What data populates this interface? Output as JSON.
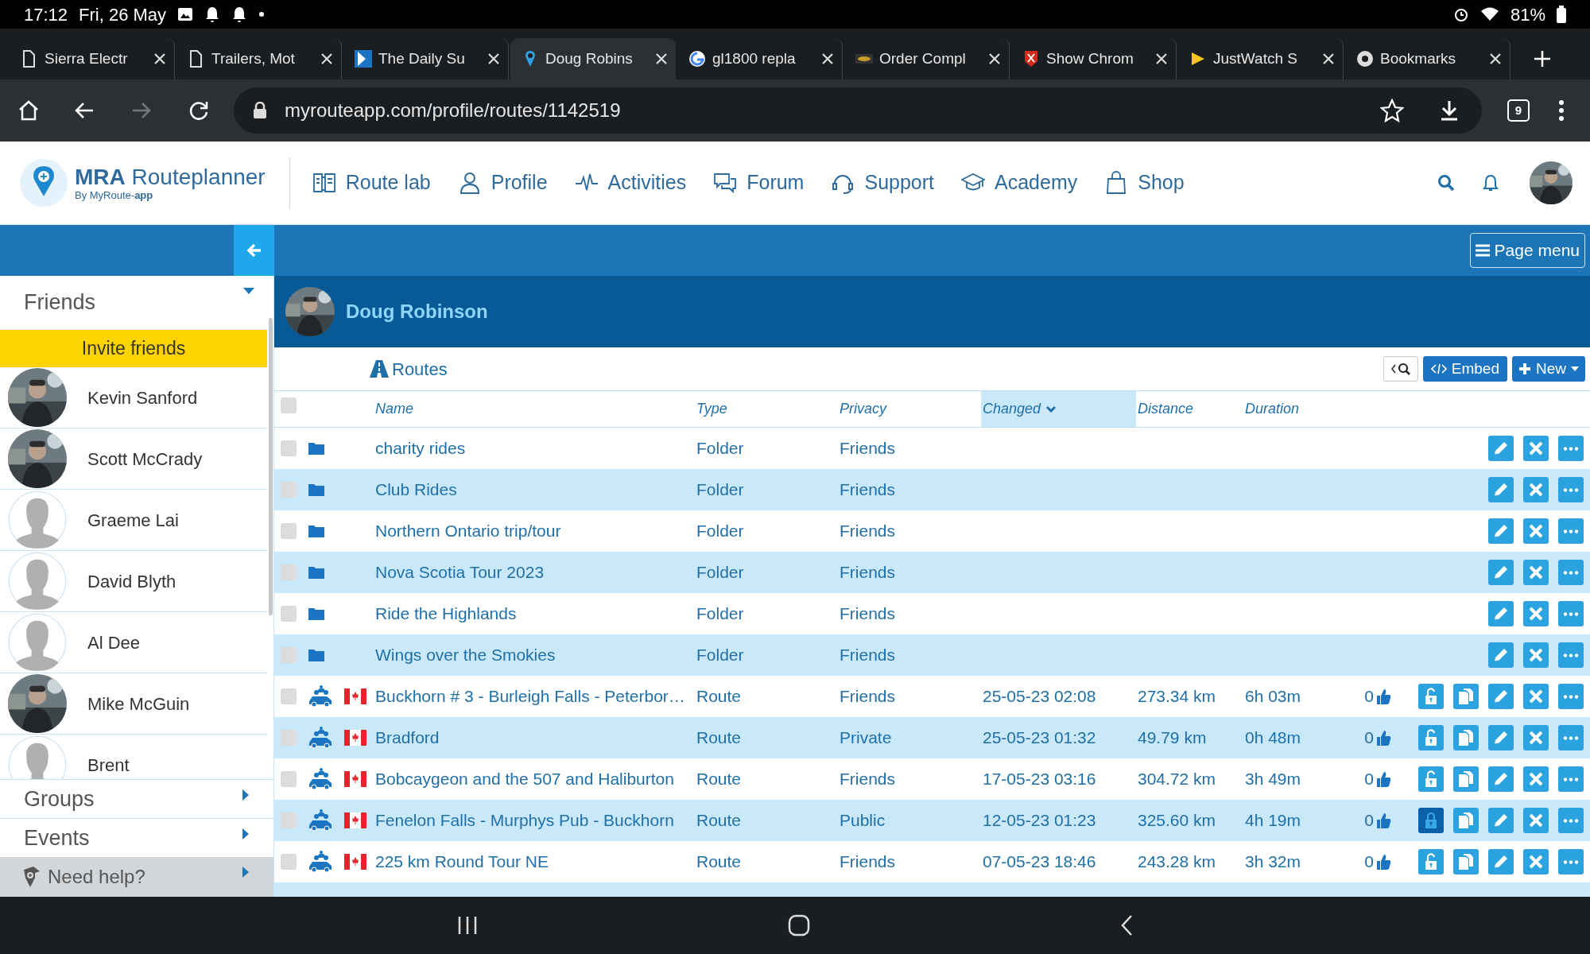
{
  "status_bar": {
    "time": "17:12",
    "date": "Fri, 26 May",
    "battery": "81%"
  },
  "browser": {
    "tabs": [
      {
        "title": "Sierra Electr",
        "selected": false
      },
      {
        "title": "Trailers, Mot",
        "selected": false
      },
      {
        "title": "The Daily Su",
        "selected": false
      },
      {
        "title": "Doug Robins",
        "selected": true
      },
      {
        "title": "gl1800 repla",
        "selected": false
      },
      {
        "title": "Order Compl",
        "selected": false
      },
      {
        "title": "Show Chrom",
        "selected": false
      },
      {
        "title": "JustWatch S",
        "selected": false
      },
      {
        "title": "Bookmarks",
        "selected": false
      }
    ],
    "url": "myrouteapp.com/profile/routes/1142519",
    "tab_count": "9"
  },
  "site_nav": {
    "logo_title": "**MRA** Routeplanner",
    "logo_subtitle": "By MyRoute-**app**",
    "items": [
      "Route lab",
      "Profile",
      "Activities",
      "Forum",
      "Support",
      "Academy",
      "Shop"
    ]
  },
  "page_menu": "Page menu",
  "sidebar": {
    "friends_header": "Friends",
    "expanded": true,
    "invite": "Invite friends",
    "friends": [
      {
        "name": "Kevin Sanford"
      },
      {
        "name": "Scott McCrady"
      },
      {
        "name": "Graeme Lai",
        "kind": "silhouette"
      },
      {
        "name": "David Blyth",
        "kind": "silhouette"
      },
      {
        "name": "Al Dee",
        "kind": "silhouette"
      },
      {
        "name": "Mike McGuin"
      },
      {
        "name": "Brent",
        "kind": "silhouette"
      }
    ],
    "sections": [
      "Groups",
      "Events"
    ],
    "help": "Need help?"
  },
  "profile": {
    "name": "Doug Robinson"
  },
  "routes_title": "Routes",
  "toolbar": {
    "embed": "Embed",
    "new": "New"
  },
  "table": {
    "select_all_checked": false,
    "columns": [
      {
        "label": "Name",
        "sorted": false
      },
      {
        "label": "Type",
        "sorted": false
      },
      {
        "label": "Privacy",
        "sorted": false
      },
      {
        "label": "Changed",
        "sorted": true
      },
      {
        "label": "Distance",
        "sorted": false
      },
      {
        "label": "Duration",
        "sorted": false
      }
    ],
    "rows": [
      {
        "kind": "folder",
        "checked": false,
        "name": "charity rides",
        "type": "Folder",
        "privacy": "Friends"
      },
      {
        "kind": "folder",
        "checked": false,
        "name": "Club Rides",
        "type": "Folder",
        "privacy": "Friends"
      },
      {
        "kind": "folder",
        "checked": false,
        "name": "Northern Ontario trip/tour",
        "type": "Folder",
        "privacy": "Friends"
      },
      {
        "kind": "folder",
        "checked": false,
        "name": "Nova Scotia Tour 2023",
        "type": "Folder",
        "privacy": "Friends"
      },
      {
        "kind": "folder",
        "checked": false,
        "name": "Ride the Highlands",
        "type": "Folder",
        "privacy": "Friends"
      },
      {
        "kind": "folder",
        "checked": false,
        "name": "Wings over the Smokies",
        "type": "Folder",
        "privacy": "Friends"
      },
      {
        "kind": "route",
        "checked": false,
        "name": "Buckhorn # 3 - Burleigh Falls - Peterbor…",
        "type": "Route",
        "privacy": "Friends",
        "changed": "25-05-23 02:08",
        "distance": "273.34 km",
        "duration": "6h 03m",
        "likes": "0",
        "locked": false
      },
      {
        "kind": "route",
        "checked": false,
        "name": "Bradford",
        "type": "Route",
        "privacy": "Private",
        "changed": "25-05-23 01:32",
        "distance": "49.79 km",
        "duration": "0h 48m",
        "likes": "0",
        "locked": false
      },
      {
        "kind": "route",
        "checked": false,
        "name": "Bobcaygeon and the 507 and Haliburton",
        "type": "Route",
        "privacy": "Friends",
        "changed": "17-05-23 03:16",
        "distance": "304.72 km",
        "duration": "3h 49m",
        "likes": "0",
        "locked": false
      },
      {
        "kind": "route",
        "checked": false,
        "name": "Fenelon Falls - Murphys Pub - Buckhorn",
        "type": "Route",
        "privacy": "Public",
        "changed": "12-05-23 01:23",
        "distance": "325.60 km",
        "duration": "4h 19m",
        "likes": "0",
        "locked": true
      },
      {
        "kind": "route",
        "checked": false,
        "name": "225 km Round Tour NE",
        "type": "Route",
        "privacy": "Friends",
        "changed": "07-05-23 18:46",
        "distance": "243.28 km",
        "duration": "3h 32m",
        "likes": "0",
        "locked": false
      }
    ]
  }
}
